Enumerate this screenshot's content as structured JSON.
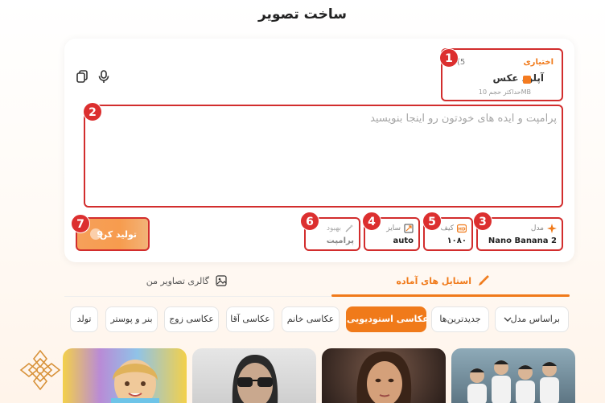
{
  "page_title": "ساخت تصویر",
  "upload": {
    "optional_label": "اختیاری",
    "count": "(5",
    "title": "آپلود عکس",
    "hint": "حداکثر حجم 10MB"
  },
  "prompt": {
    "placeholder": "پرامپت و ایده های خودتون رو اینجا بنویسید",
    "value": ""
  },
  "options": {
    "model": {
      "label": "مدل",
      "value": "Nano Banana 2"
    },
    "quality": {
      "label": "کیف",
      "value": "۱۰۸۰"
    },
    "size": {
      "label": "سایز",
      "value": "auto"
    },
    "improve": {
      "label": "بهبود",
      "value": "پرامپت"
    }
  },
  "generate": {
    "label": "تولید کن",
    "count": "9"
  },
  "annotations": [
    "1",
    "2",
    "3",
    "4",
    "5",
    "6",
    "7"
  ],
  "tabs": {
    "ready_styles": "استایل های آماده",
    "my_gallery": "گالری تصاویر من"
  },
  "filters": {
    "sort_select": "براساس مدل",
    "chips": [
      "جدیدترین‌ها",
      "عکاسی استودیویی",
      "عکاسی خانم",
      "عکاسی آقا",
      "عکاسی زوج",
      "بنر و پوستر",
      "تولد"
    ],
    "active_index": 1
  },
  "colors": {
    "accent": "#f07a1a",
    "annotation": "#dc2f2f"
  },
  "icons": [
    "microphone-icon",
    "copy-icon",
    "upload-image-icon",
    "sparkle-icon",
    "hd-icon",
    "resize-icon",
    "magic-wand-icon",
    "brush-icon",
    "gallery-icon",
    "chevron-down-icon",
    "ornament-logo-icon"
  ]
}
